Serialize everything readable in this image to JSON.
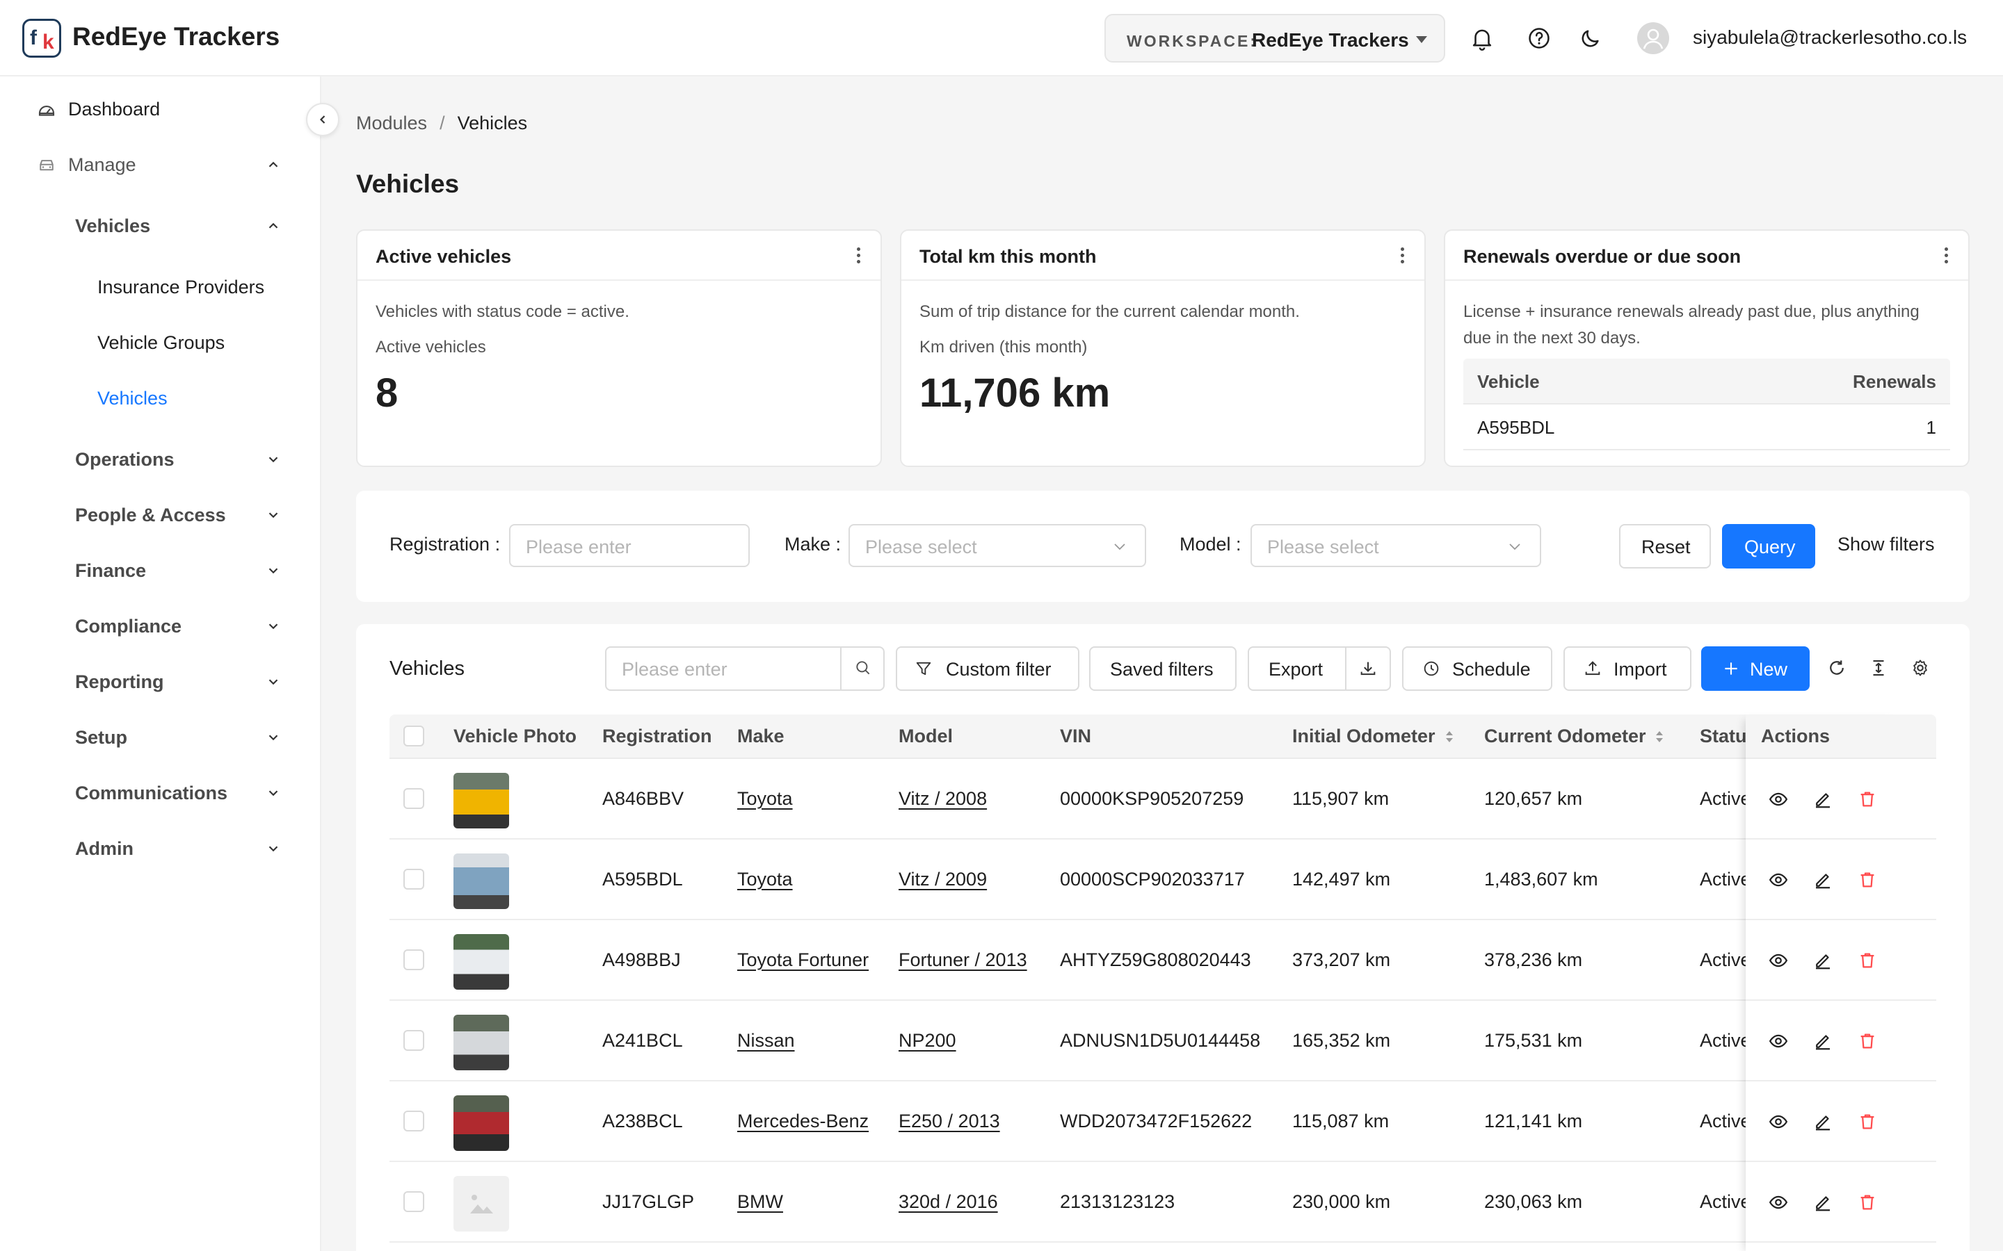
{
  "header": {
    "app_title": "RedEye Trackers",
    "workspace_label": "WORKSPACE:",
    "workspace_value": "RedEye Trackers",
    "user_email": "siyabulela@trackerlesotho.co.ls",
    "icons": [
      "bell-icon",
      "help-icon",
      "moon-icon",
      "user-avatar-icon"
    ]
  },
  "sidebar": {
    "dashboard": "Dashboard",
    "manage": "Manage",
    "vehicles_group": "Vehicles",
    "sub_items": [
      "Insurance Providers",
      "Vehicle Groups",
      "Vehicles"
    ],
    "sections": [
      "Operations",
      "People & Access",
      "Finance",
      "Compliance",
      "Reporting",
      "Setup",
      "Communications",
      "Admin"
    ]
  },
  "breadcrumb": {
    "parent": "Modules",
    "separator": "/",
    "current": "Vehicles"
  },
  "page_title": "Vehicles",
  "cards": {
    "active": {
      "title": "Active vehicles",
      "desc": "Vehicles with status code = active.",
      "label": "Active vehicles",
      "value": "8"
    },
    "km": {
      "title": "Total km this month",
      "desc": "Sum of trip distance for the current calendar month.",
      "label": "Km driven (this month)",
      "value": "11,706 km"
    },
    "renewals": {
      "title": "Renewals overdue or due soon",
      "desc": "License + insurance renewals already past due, plus anything due in the next 30 days.",
      "col_vehicle": "Vehicle",
      "col_renewals": "Renewals",
      "rows": [
        {
          "vehicle": "A595BDL",
          "renewals": "1"
        }
      ]
    }
  },
  "filters": {
    "registration_label": "Registration",
    "registration_placeholder": "Please enter",
    "make_label": "Make",
    "make_placeholder": "Please select",
    "model_label": "Model",
    "model_placeholder": "Please select",
    "reset": "Reset",
    "query": "Query",
    "show_filters": "Show filters"
  },
  "toolbar": {
    "title": "Vehicles",
    "search_placeholder": "Please enter",
    "custom_filter": "Custom filter",
    "saved_filters": "Saved filters",
    "export": "Export",
    "schedule": "Schedule",
    "import": "Import",
    "new": "New"
  },
  "table": {
    "columns": [
      "Vehicle Photo",
      "Registration",
      "Make",
      "Model",
      "VIN",
      "Initial Odometer",
      "Current Odometer",
      "Status",
      "Actions"
    ],
    "rows": [
      {
        "photo": "yellow",
        "registration": "A846BBV",
        "make": "Toyota",
        "model": "Vitz / 2008",
        "vin": "00000KSP905207259",
        "initial": "115,907 km",
        "current": "120,657 km",
        "status": "Active (active)"
      },
      {
        "photo": "blue",
        "registration": "A595BDL",
        "make": "Toyota",
        "model": "Vitz / 2009",
        "vin": "00000SCP902033717",
        "initial": "142,497 km",
        "current": "1,483,607 km",
        "status": "Active (active)"
      },
      {
        "photo": "white",
        "registration": "A498BBJ",
        "make": "Toyota Fortuner",
        "model": "Fortuner / 2013",
        "vin": "AHTYZ59G808020443",
        "initial": "373,207 km",
        "current": "378,236 km",
        "status": "Active (active)"
      },
      {
        "photo": "silver",
        "registration": "A241BCL",
        "make": "Nissan",
        "model": "NP200",
        "vin": "ADNUSN1D5U0144458",
        "initial": "165,352 km",
        "current": "175,531 km",
        "status": "Active (active)"
      },
      {
        "photo": "red",
        "registration": "A238BCL",
        "make": "Mercedes-Benz",
        "model": "E250 / 2013",
        "vin": "WDD2073472F152622",
        "initial": "115,087 km",
        "current": "121,141 km",
        "status": "Active (active)"
      },
      {
        "photo": "none",
        "registration": "JJ17GLGP",
        "make": "BMW",
        "model": "320d / 2016",
        "vin": "21313123123",
        "initial": "230,000 km",
        "current": "230,063 km",
        "status": "Active (active)"
      }
    ]
  },
  "colors": {
    "primary": "#1677ff",
    "danger": "#ff4d4f",
    "brand_dark": "#1f3b5a",
    "brand_red": "#e0393e"
  }
}
